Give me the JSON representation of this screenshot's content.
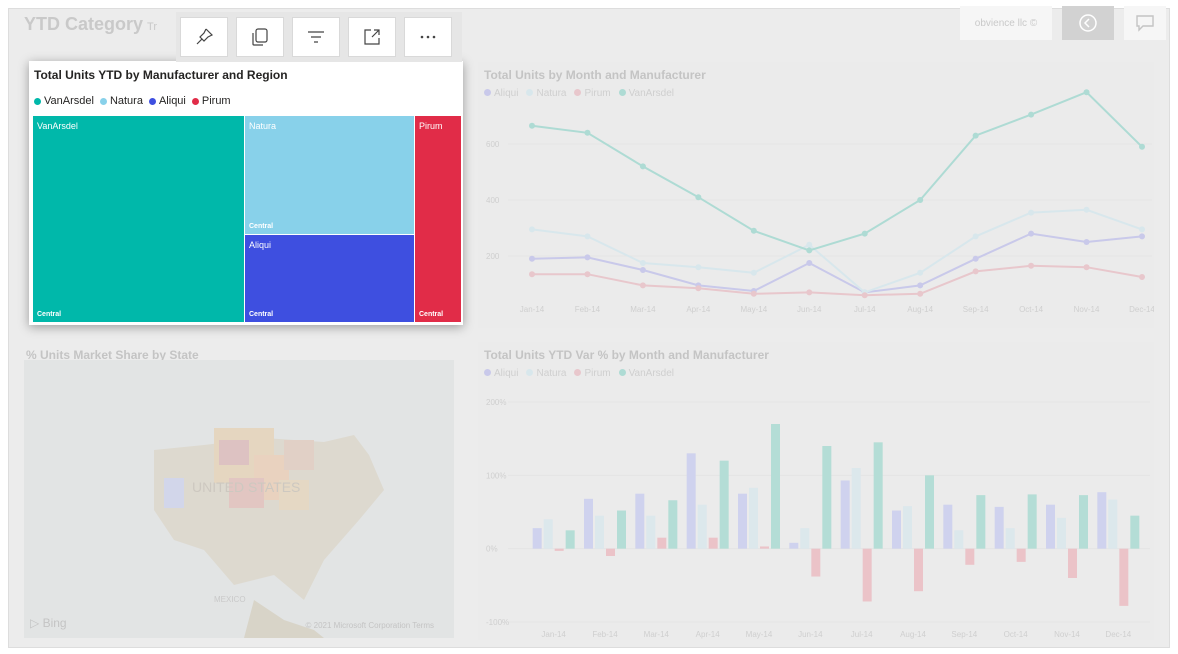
{
  "header": {
    "page_title": "YTD Category",
    "page_title_suffix": "Tr",
    "brand_text": "obvience llc ©"
  },
  "toolbar": {
    "buttons": [
      {
        "name": "pin-visual-button",
        "icon": "pin-icon"
      },
      {
        "name": "copy-visual-button",
        "icon": "copy-icon"
      },
      {
        "name": "filter-button",
        "icon": "filter-icon"
      },
      {
        "name": "focus-mode-button",
        "icon": "expand-icon"
      },
      {
        "name": "more-options-button",
        "icon": "ellipsis-icon"
      }
    ]
  },
  "treemap": {
    "title": "Total Units YTD by Manufacturer and Region",
    "legend": [
      {
        "label": "VanArsdel",
        "color": "#00b8aa"
      },
      {
        "label": "Natura",
        "color": "#88d1ea"
      },
      {
        "label": "Aliqui",
        "color": "#3e4fe0"
      },
      {
        "label": "Pirum",
        "color": "#e12c48"
      }
    ],
    "tiles": {
      "vanarsdel": {
        "label": "VanArsdel",
        "sub": "Central"
      },
      "natura": {
        "label": "Natura",
        "sub": "Central"
      },
      "aliqui": {
        "label": "Aliqui",
        "sub": "Central"
      },
      "pirum": {
        "label": "Pirum",
        "sub": "Central"
      }
    }
  },
  "line_visual": {
    "title": "Total Units by Month and Manufacturer",
    "legend": [
      "Aliqui",
      "Natura",
      "Pirum",
      "VanArsdel"
    ]
  },
  "bar_visual": {
    "title": "Total Units YTD Var % by Month and Manufacturer",
    "legend": [
      "Aliqui",
      "Natura",
      "Pirum",
      "VanArsdel"
    ]
  },
  "map_visual": {
    "title": "% Units Market Share by State",
    "bing": "Bing",
    "copyright": "© 2021 Microsoft Corporation",
    "terms": "Terms",
    "country_label": "UNITED STATES",
    "mexico_label": "MEXICO"
  },
  "chart_data": [
    {
      "type": "line",
      "title": "Total Units by Month and Manufacturer",
      "categories": [
        "Jan-14",
        "Feb-14",
        "Mar-14",
        "Apr-14",
        "May-14",
        "Jun-14",
        "Jul-14",
        "Aug-14",
        "Sep-14",
        "Oct-14",
        "Nov-14",
        "Dec-14"
      ],
      "yticks": [
        "600",
        "400",
        "200"
      ],
      "ylim": [
        0,
        750
      ],
      "series": [
        {
          "name": "Aliqui",
          "color": "#c9c9ea",
          "values": [
            190,
            195,
            150,
            95,
            75,
            175,
            70,
            95,
            190,
            280,
            250,
            270
          ]
        },
        {
          "name": "Natura",
          "color": "#d8e7ec",
          "values": [
            295,
            270,
            175,
            160,
            140,
            240,
            70,
            140,
            270,
            355,
            365,
            295
          ]
        },
        {
          "name": "Pirum",
          "color": "#e8c7cc",
          "values": [
            135,
            135,
            95,
            85,
            65,
            70,
            60,
            65,
            145,
            165,
            160,
            125
          ]
        },
        {
          "name": "VanArsdel",
          "color": "#aedbd4",
          "values": [
            665,
            640,
            520,
            410,
            290,
            220,
            280,
            400,
            630,
            705,
            785,
            590
          ]
        }
      ]
    },
    {
      "type": "bar",
      "title": "Total Units YTD Var % by Month and Manufacturer",
      "categories": [
        "Jan-14",
        "Feb-14",
        "Mar-14",
        "Apr-14",
        "May-14",
        "Jun-14",
        "Jul-14",
        "Aug-14",
        "Sep-14",
        "Oct-14",
        "Nov-14",
        "Dec-14"
      ],
      "yticks": [
        "200%",
        "100%",
        "0%",
        "-100%"
      ],
      "ylim": [
        -100,
        200
      ],
      "series": [
        {
          "name": "Aliqui",
          "color": "#cfd2ee",
          "values": [
            28,
            68,
            75,
            130,
            75,
            8,
            93,
            52,
            60,
            57,
            60,
            77
          ]
        },
        {
          "name": "Natura",
          "color": "#dce8ec",
          "values": [
            40,
            45,
            45,
            60,
            83,
            28,
            110,
            58,
            25,
            28,
            42,
            67
          ]
        },
        {
          "name": "Pirum",
          "color": "#ebc3c8",
          "values": [
            -3,
            -10,
            15,
            15,
            3,
            -38,
            -72,
            -58,
            -22,
            -18,
            -40,
            -78
          ]
        },
        {
          "name": "VanArsdel",
          "color": "#b4ddd6",
          "values": [
            25,
            52,
            66,
            120,
            170,
            140,
            145,
            100,
            73,
            74,
            73,
            45
          ]
        }
      ]
    }
  ]
}
